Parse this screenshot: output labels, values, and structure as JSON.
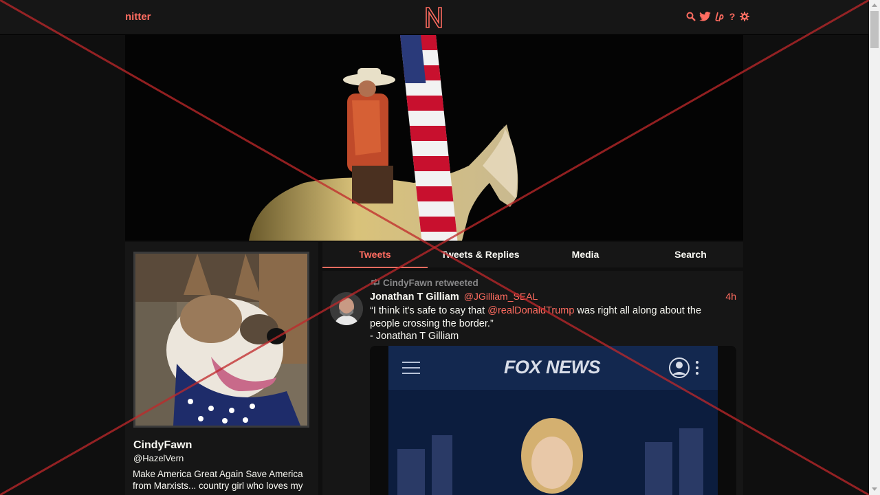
{
  "navbar": {
    "brand": "nitter",
    "logo_letter": "N",
    "icons": [
      "search-icon",
      "twitter-bird-icon",
      "liberapay-icon",
      "help-icon",
      "settings-gear-icon"
    ],
    "help_glyph": "?"
  },
  "profile": {
    "fullname": "CindyFawn",
    "username": "@HazelVern",
    "bio": "Make America Great Again Save America from Marxists... country girl who loves my"
  },
  "tabs": [
    {
      "label": "Tweets",
      "active": true
    },
    {
      "label": "Tweets & Replies",
      "active": false
    },
    {
      "label": "Media",
      "active": false
    },
    {
      "label": "Search",
      "active": false
    }
  ],
  "tweet": {
    "retweet_label": "CindyFawn retweeted",
    "fullname": "Jonathan T Gilliam",
    "username": "@JGilliam_SEAL",
    "date": "4h",
    "content_before": "“I think it's safe to say that ",
    "mention": "@realDonaldTrump",
    "content_after": " was right all along about the people crossing the border.”",
    "signature": "- Jonathan T Gilliam",
    "media_brand": "FOX NEWS"
  },
  "colors": {
    "accent": "#ff6c60",
    "background": "#0f0f0f",
    "panel": "#161616",
    "overlay_cross": "#c0282a"
  }
}
